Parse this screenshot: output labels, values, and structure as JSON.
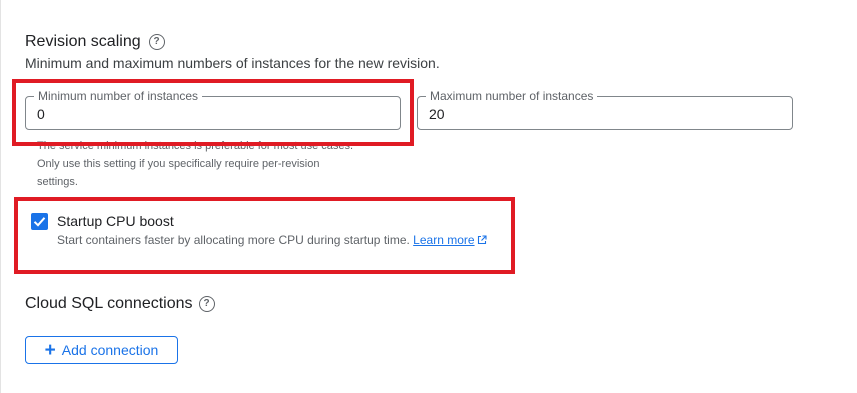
{
  "revision_scaling": {
    "title": "Revision scaling",
    "help_icon": "help-circle-icon",
    "subtitle": "Minimum and maximum numbers of instances for the new revision.",
    "min_field": {
      "label": "Minimum number of instances",
      "value": "0"
    },
    "max_field": {
      "label": "Maximum number of instances",
      "value": "20"
    },
    "helper_text": "The service minimum instances is preferable for most use cases. Only use this setting if you specifically require per-revision settings."
  },
  "startup_boost": {
    "checked": true,
    "label": "Startup CPU boost",
    "description": "Start containers faster by allocating more CPU during startup time.",
    "learn_more": "Learn more",
    "learn_more_icon": "open-in-new-icon"
  },
  "cloud_sql": {
    "title": "Cloud SQL connections",
    "help_icon": "help-circle-icon",
    "add_button": "Add connection",
    "add_icon": "plus-icon"
  },
  "colors": {
    "accent": "#1a73e8",
    "highlight": "#e01b24"
  }
}
